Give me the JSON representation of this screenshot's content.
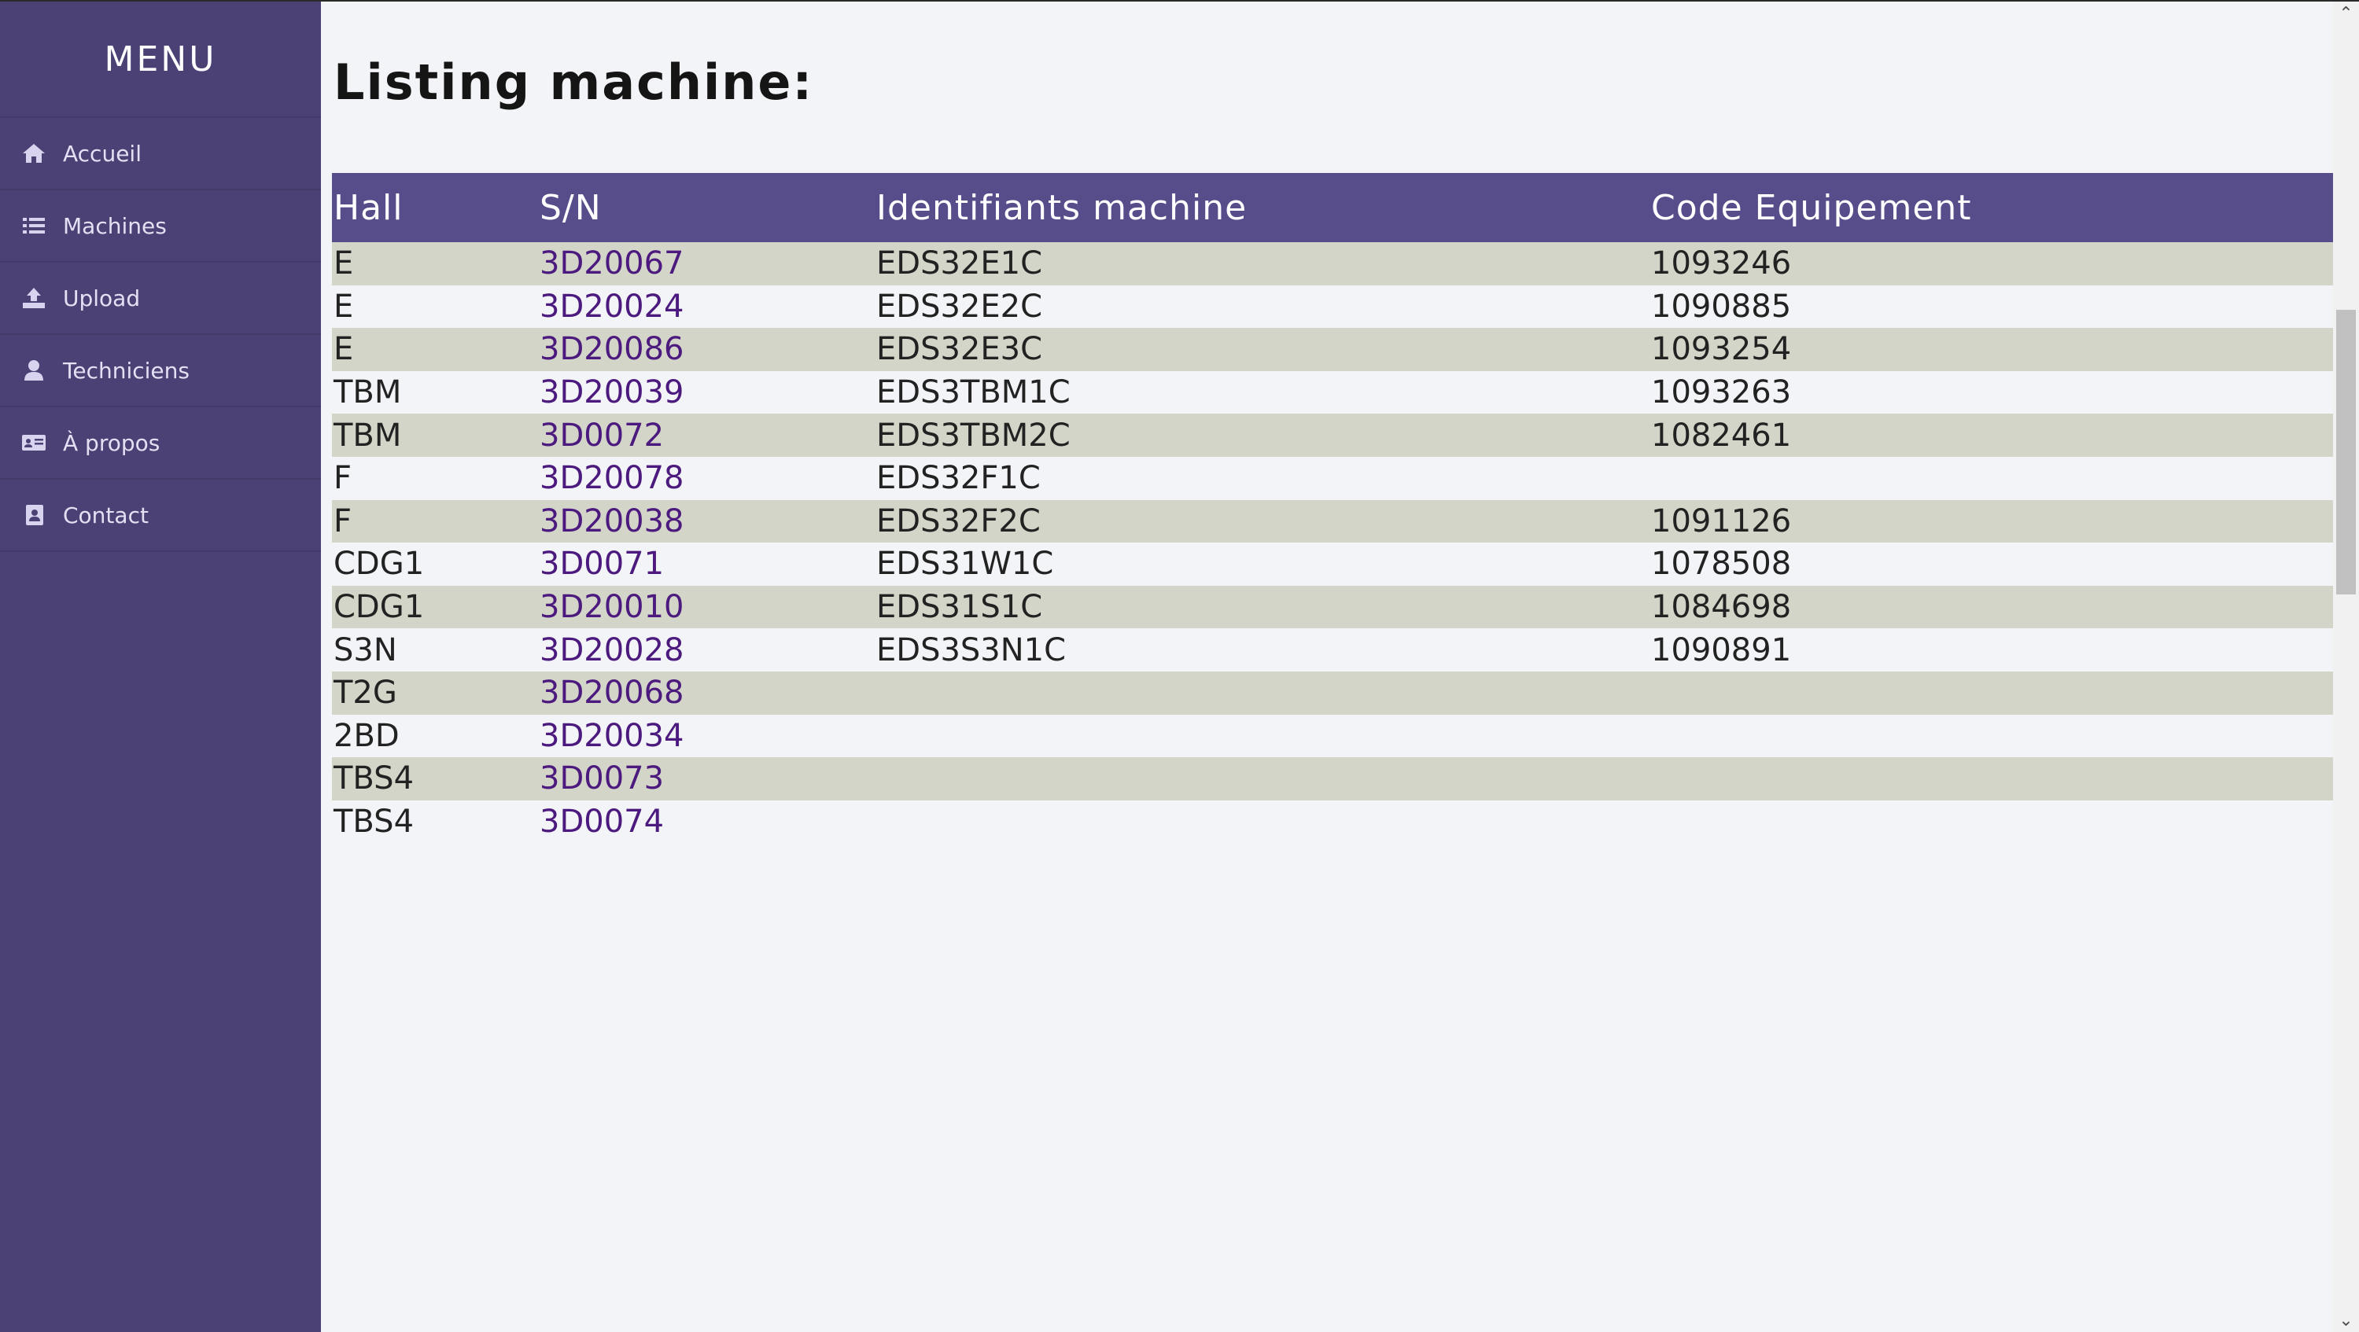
{
  "sidebar": {
    "title": "MENU",
    "items": [
      {
        "label": "Accueil",
        "icon": "home-icon"
      },
      {
        "label": "Machines",
        "icon": "list-icon"
      },
      {
        "label": "Upload",
        "icon": "upload-icon"
      },
      {
        "label": "Techniciens",
        "icon": "user-icon"
      },
      {
        "label": "À propos",
        "icon": "id-card-icon"
      },
      {
        "label": "Contact",
        "icon": "contact-book-icon"
      }
    ]
  },
  "main": {
    "title": "Listing machine:",
    "table": {
      "columns": [
        "Hall",
        "S/N",
        "Identifiants machine",
        "Code Equipement"
      ],
      "rows": [
        {
          "hall": "E",
          "sn": "3D20067",
          "id": "EDS32E1C",
          "code": "1093246"
        },
        {
          "hall": "E",
          "sn": "3D20024",
          "id": "EDS32E2C",
          "code": "1090885"
        },
        {
          "hall": "E",
          "sn": "3D20086",
          "id": "EDS32E3C",
          "code": "1093254"
        },
        {
          "hall": "TBM",
          "sn": "3D20039",
          "id": "EDS3TBM1C",
          "code": "1093263"
        },
        {
          "hall": "TBM",
          "sn": "3D0072",
          "id": "EDS3TBM2C",
          "code": "1082461"
        },
        {
          "hall": "F",
          "sn": "3D20078",
          "id": "EDS32F1C",
          "code": ""
        },
        {
          "hall": "F",
          "sn": "3D20038",
          "id": "EDS32F2C",
          "code": "1091126"
        },
        {
          "hall": "CDG1",
          "sn": "3D0071",
          "id": "EDS31W1C",
          "code": "1078508"
        },
        {
          "hall": "CDG1",
          "sn": "3D20010",
          "id": "EDS31S1C",
          "code": "1084698"
        },
        {
          "hall": "S3N",
          "sn": "3D20028",
          "id": "EDS3S3N1C",
          "code": "1090891"
        },
        {
          "hall": "T2G",
          "sn": "3D20068",
          "id": "",
          "code": ""
        },
        {
          "hall": "2BD",
          "sn": "3D20034",
          "id": "",
          "code": ""
        },
        {
          "hall": "TBS4",
          "sn": "3D0073",
          "id": "",
          "code": ""
        },
        {
          "hall": "TBS4",
          "sn": "3D0074",
          "id": "",
          "code": ""
        }
      ]
    }
  },
  "colors": {
    "sidebar_bg": "#4b4175",
    "header_bg": "#584d8b",
    "stripe": "#d4d5c9",
    "link": "#4c1a7e"
  }
}
